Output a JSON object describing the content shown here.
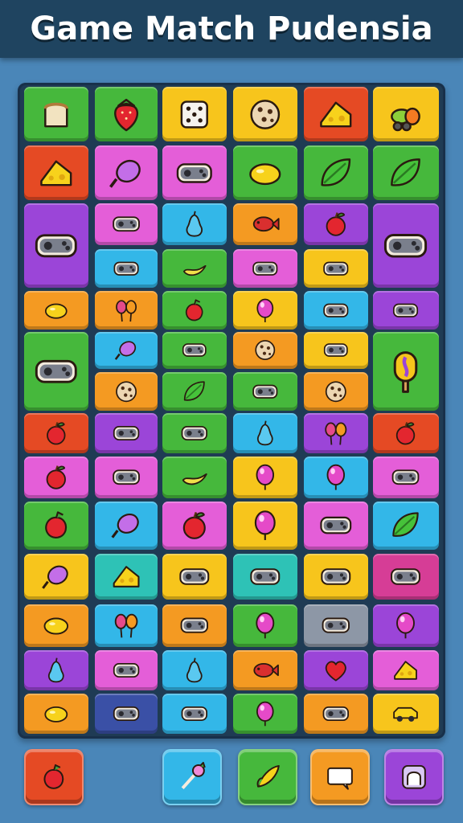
{
  "header": {
    "title": "Game Match Pudensia"
  },
  "palette": {
    "green": "#46b83c",
    "red": "#e54a24",
    "yellow": "#f7c51c",
    "orange": "#f49a22",
    "pink": "#e45ed8",
    "cyan": "#33b7e8",
    "purple": "#9b45d8",
    "teal": "#2ec2b6",
    "gray": "#8d97a6",
    "navy": "#3a50a6",
    "magenta": "#d63d96"
  },
  "board": {
    "rows": [
      [
        {
          "c": "green",
          "i": "toast-icon"
        },
        {
          "c": "green",
          "i": "strawberry-icon"
        },
        {
          "c": "yellow",
          "i": "dice-icon"
        },
        {
          "c": "yellow",
          "i": "cookie-icon"
        },
        {
          "c": "red",
          "i": "cheese-icon"
        },
        {
          "c": "yellow",
          "i": "fruit-bunch-icon"
        }
      ],
      [
        {
          "c": "red",
          "i": "cheese-icon"
        },
        {
          "c": "pink",
          "i": "candy-icon"
        },
        {
          "c": "pink",
          "i": "gamepad-icon"
        },
        {
          "c": "green",
          "i": "lemon-icon"
        },
        {
          "c": "green",
          "i": "leaf-icon"
        },
        {
          "c": "green",
          "i": "leaf-icon"
        }
      ],
      [
        {
          "c": "purple",
          "i": "gamepad-icon",
          "tall": true
        },
        {
          "c": "pink",
          "i": "gamepad-icon"
        },
        {
          "c": "cyan",
          "i": "pear-icon"
        },
        {
          "c": "orange",
          "i": "fish-icon"
        },
        {
          "c": "purple",
          "i": "apple-icon"
        },
        {
          "c": "purple",
          "i": "gamepad-icon",
          "tall": true
        }
      ],
      [
        null,
        {
          "c": "cyan",
          "i": "gamepad-icon"
        },
        {
          "c": "green",
          "i": "banana-icon"
        },
        {
          "c": "pink",
          "i": "gamepad-icon"
        },
        {
          "c": "yellow",
          "i": "gamepad-icon"
        },
        null
      ],
      [
        {
          "c": "orange",
          "i": "lemon-icon"
        },
        {
          "c": "orange",
          "i": "balloons-icon"
        },
        {
          "c": "green",
          "i": "pepper-icon"
        },
        {
          "c": "yellow",
          "i": "balloon-icon"
        },
        {
          "c": "cyan",
          "i": "gamepad-icon"
        },
        {
          "c": "purple",
          "i": "gamepad-icon"
        }
      ],
      [
        {
          "c": "green",
          "i": "gamepad-icon",
          "tall": true
        },
        {
          "c": "cyan",
          "i": "candy-icon"
        },
        {
          "c": "green",
          "i": "gamepad-icon"
        },
        {
          "c": "orange",
          "i": "cookie-icon"
        },
        {
          "c": "yellow",
          "i": "gamepad-icon"
        },
        {
          "c": "green",
          "i": "popsicle-icon",
          "tall": true
        }
      ],
      [
        null,
        {
          "c": "orange",
          "i": "cookie-icon"
        },
        {
          "c": "green",
          "i": "leaf-icon"
        },
        {
          "c": "green",
          "i": "gamepad-icon"
        },
        {
          "c": "orange",
          "i": "cookie-icon"
        },
        null
      ],
      [
        {
          "c": "red",
          "i": "apple-icon"
        },
        {
          "c": "purple",
          "i": "gamepad-icon"
        },
        {
          "c": "green",
          "i": "gamepad-icon"
        },
        {
          "c": "cyan",
          "i": "pear-icon"
        },
        {
          "c": "purple",
          "i": "balloons-icon"
        },
        {
          "c": "red",
          "i": "apple-icon"
        }
      ],
      [
        {
          "c": "pink",
          "i": "apple-icon"
        },
        {
          "c": "pink",
          "i": "gamepad-icon"
        },
        {
          "c": "green",
          "i": "banana-icon"
        },
        {
          "c": "yellow",
          "i": "balloon-icon"
        },
        {
          "c": "cyan",
          "i": "balloon-icon"
        },
        {
          "c": "pink",
          "i": "gamepad-icon"
        }
      ],
      [
        {
          "c": "green",
          "i": "pepper-icon"
        },
        {
          "c": "cyan",
          "i": "candy-icon"
        },
        {
          "c": "pink",
          "i": "apple-icon"
        },
        {
          "c": "yellow",
          "i": "balloon-icon"
        },
        {
          "c": "pink",
          "i": "gamepad-icon"
        },
        {
          "c": "cyan",
          "i": "leaf-icon"
        }
      ],
      [
        {
          "c": "yellow",
          "i": "candy-icon"
        },
        {
          "c": "teal",
          "i": "cheese-icon"
        },
        {
          "c": "yellow",
          "i": "gamepad-icon"
        },
        {
          "c": "teal",
          "i": "gamepad-icon"
        },
        {
          "c": "yellow",
          "i": "gamepad-icon"
        },
        {
          "c": "magenta",
          "i": "gamepad-icon"
        }
      ],
      [
        {
          "c": "orange",
          "i": "lemon-icon"
        },
        {
          "c": "cyan",
          "i": "balloons-icon"
        },
        {
          "c": "orange",
          "i": "gamepad-icon"
        },
        {
          "c": "green",
          "i": "balloon-icon"
        },
        {
          "c": "gray",
          "i": "gamepad-icon"
        },
        {
          "c": "purple",
          "i": "balloon-icon"
        }
      ],
      [
        {
          "c": "purple",
          "i": "pear-icon"
        },
        {
          "c": "pink",
          "i": "gamepad-icon"
        },
        {
          "c": "cyan",
          "i": "pear-icon"
        },
        {
          "c": "orange",
          "i": "fish-icon"
        },
        {
          "c": "purple",
          "i": "heart-icon"
        },
        {
          "c": "pink",
          "i": "cheese-icon"
        }
      ],
      [
        {
          "c": "orange",
          "i": "lemon-icon"
        },
        {
          "c": "navy",
          "i": "gamepad-icon"
        },
        {
          "c": "cyan",
          "i": "gamepad-icon"
        },
        {
          "c": "green",
          "i": "balloon-icon"
        },
        {
          "c": "orange",
          "i": "gamepad-icon"
        },
        {
          "c": "yellow",
          "i": "car-icon"
        }
      ]
    ]
  },
  "tray": [
    {
      "name": "tray-slot-pepper",
      "c": "red",
      "i": "pepper-icon"
    },
    {
      "name": "tray-slot-wand",
      "c": "cyan",
      "i": "wand-icon"
    },
    {
      "name": "tray-slot-corn",
      "c": "green",
      "i": "corn-icon"
    },
    {
      "name": "tray-slot-tablet",
      "c": "orange",
      "i": "tablet-icon"
    },
    {
      "name": "tray-slot-portal",
      "c": "purple",
      "i": "portal-icon"
    }
  ]
}
